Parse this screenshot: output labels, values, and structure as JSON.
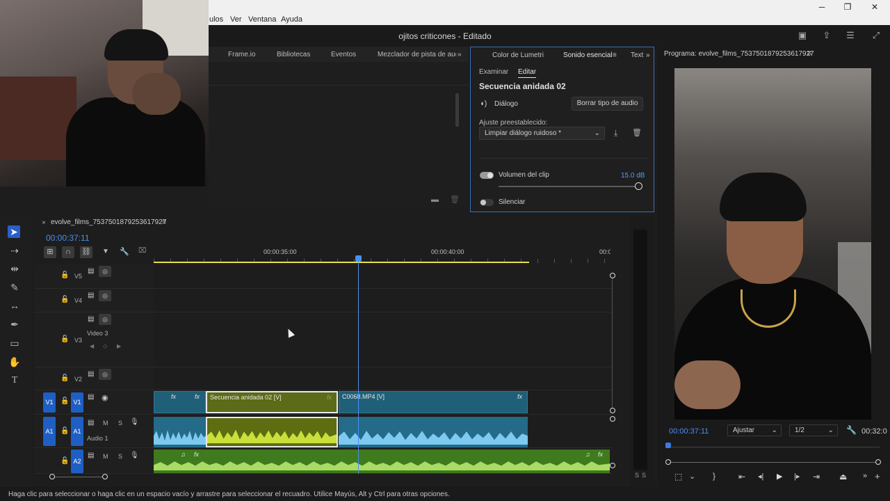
{
  "menubar": {
    "items": [
      "ulos",
      "Ver",
      "Ventana",
      "Ayuda"
    ]
  },
  "app": {
    "title": "ojitos criticones - Editado"
  },
  "tabs_left": [
    "Frame.io",
    "Bibliotecas",
    "Eventos",
    "Mezclador de pista de audio"
  ],
  "essential_sound": {
    "tabs": [
      "Color de Lumetri",
      "Sonido esencial",
      "Text"
    ],
    "subtabs": [
      "Examinar",
      "Editar"
    ],
    "sequence": "Secuencia anidada 02",
    "type_label": "Diálogo",
    "clear_button": "Borrar tipo de audio",
    "preset_label": "Ajuste preestablecido:",
    "preset_value": "Limpiar diálogo ruidoso *",
    "clip_volume_label": "Volumen del clip",
    "clip_volume_value": "15.0 dB",
    "clip_volume_toggle": true,
    "mute_label": "Silenciar",
    "mute_toggle": false,
    "accent_color": "#3a6db5"
  },
  "program": {
    "title": "Programa: evolve_films_7537501879253617927",
    "timecode": "00:00:37:11",
    "fit": "Ajustar",
    "resolution": "1/2",
    "end_timecode": "00:32:0"
  },
  "timeline": {
    "sequence_name": "evolve_films_7537501879253617927",
    "timecode": "00:00:37:11",
    "ruler": [
      "00:00:35:00",
      "00:00:40:00",
      "00:0"
    ],
    "tracks": {
      "v5": "V5",
      "v4": "V4",
      "v3": "V3",
      "v3_name": "Video 3",
      "v2": "V2",
      "v1": "V1",
      "v1_src": "V1",
      "a1": "A1",
      "a1_src": "A1",
      "a1_name": "Audio 1",
      "a2": "A2",
      "m": "M",
      "s": "S"
    },
    "clips": {
      "nested": "Secuencia anidada 02 [V]",
      "c0068": "C0068.MP4 [V]",
      "fx": "fx"
    }
  },
  "meter": {
    "labels": [
      "S",
      "S"
    ]
  },
  "status": "Haga clic para seleccionar o haga clic en un espacio vacío y arrastre para seleccionar el recuadro. Utilice Mayús, Alt y Ctrl para otras opciones."
}
